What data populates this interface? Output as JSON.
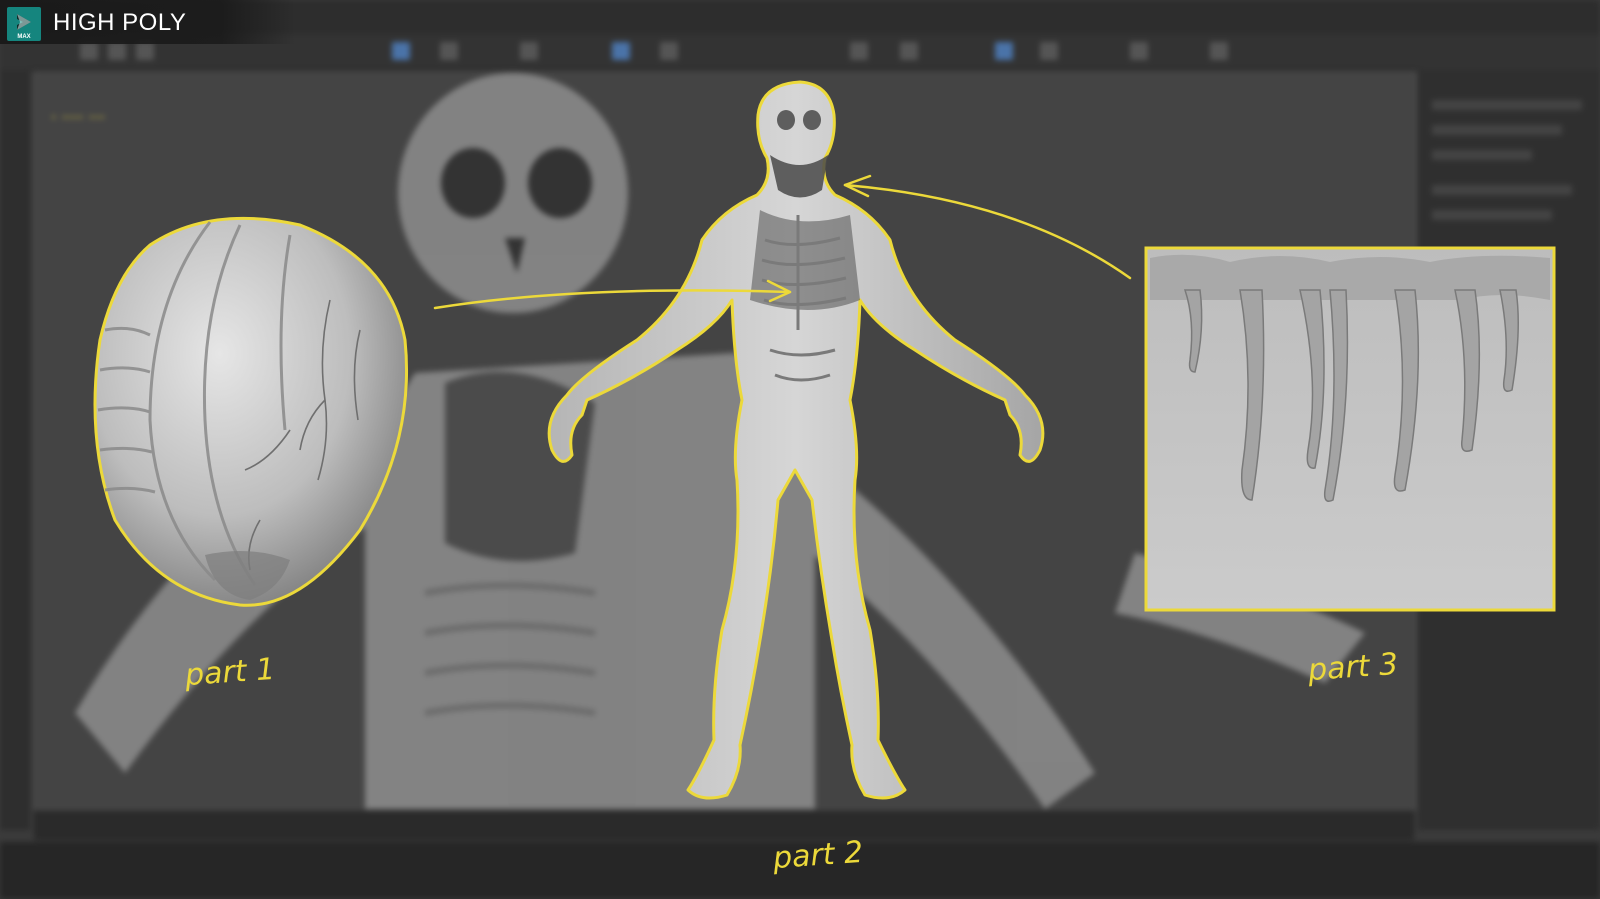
{
  "header": {
    "title": "HIGH POLY",
    "app_icon": "3ds-max-logo",
    "app_icon_caption": "MAX"
  },
  "parts": [
    {
      "label": "part 1",
      "icon": "alien-head-sculpt"
    },
    {
      "label": "part 2",
      "icon": "flayed-humanoid-body"
    },
    {
      "label": "part 3",
      "icon": "dripping-tendrils-panel"
    }
  ],
  "colors": {
    "highlight": "#ecd93a",
    "logo": "#15857e",
    "viewport_bg": "#444444"
  }
}
